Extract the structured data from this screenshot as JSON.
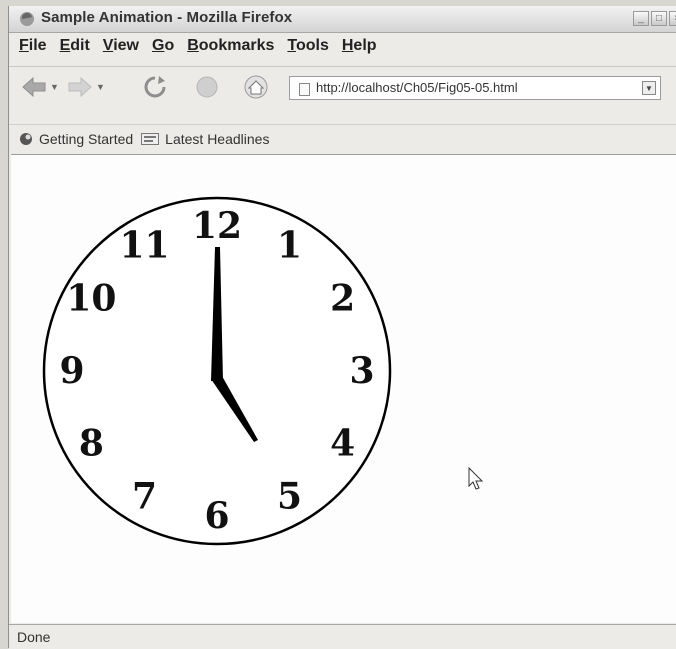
{
  "window": {
    "title": "Sample Animation - Mozilla Firefox"
  },
  "menu": [
    {
      "label": "File",
      "key": "F",
      "rest": "ile"
    },
    {
      "label": "Edit",
      "key": "E",
      "rest": "dit"
    },
    {
      "label": "View",
      "key": "V",
      "rest": "iew"
    },
    {
      "label": "Go",
      "key": "G",
      "rest": "o"
    },
    {
      "label": "Bookmarks",
      "key": "B",
      "rest": "ookmarks"
    },
    {
      "label": "Tools",
      "key": "T",
      "rest": "ools"
    },
    {
      "label": "Help",
      "key": "H",
      "rest": "elp"
    }
  ],
  "urlbar": {
    "url": "http://localhost/Ch05/Fig05-05.html"
  },
  "bookmarks": [
    "Getting Started",
    "Latest Headlines"
  ],
  "clock": {
    "numerals": [
      "12",
      "1",
      "2",
      "3",
      "4",
      "5",
      "6",
      "7",
      "8",
      "9",
      "10",
      "11"
    ],
    "hour": 5,
    "minute": 0
  },
  "status": {
    "text": "Done"
  },
  "colors": {
    "chrome": "#ecebe7",
    "content": "#fdfdfd"
  }
}
